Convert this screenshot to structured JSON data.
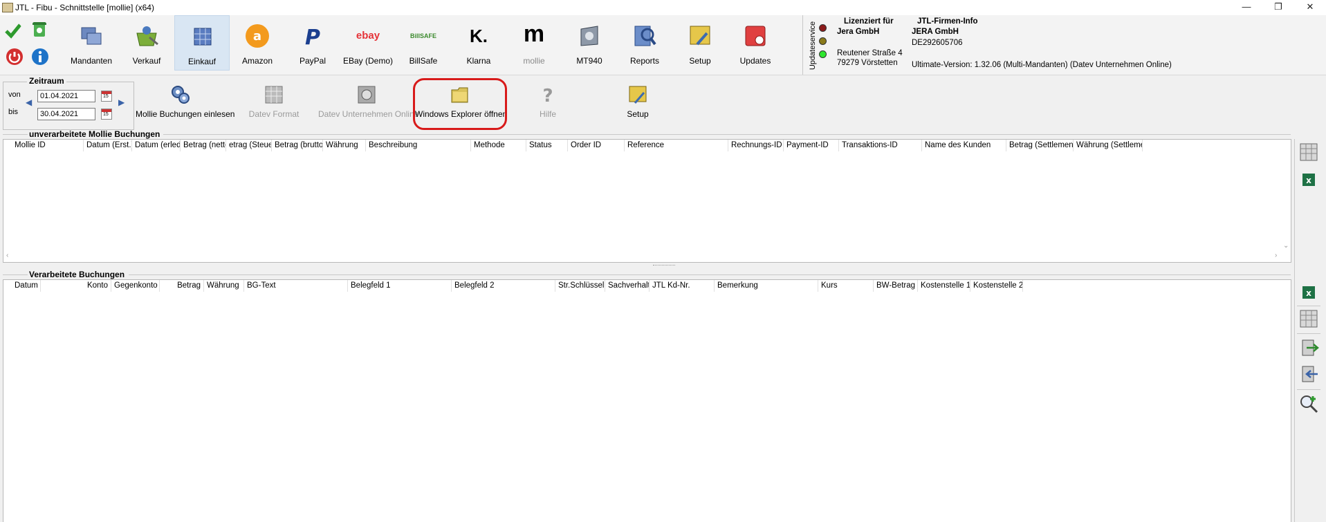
{
  "window": {
    "title": "JTL - Fibu - Schnittstelle [mollie] (x64)",
    "min": "—",
    "max": "❐",
    "close": "✕"
  },
  "modules": [
    {
      "label": "Mandanten",
      "icon": "mandanten-icon"
    },
    {
      "label": "Verkauf",
      "icon": "verkauf-basket-icon"
    },
    {
      "label": "Einkauf",
      "icon": "einkauf-icon"
    },
    {
      "label": "Amazon",
      "icon": "amazon-icon"
    },
    {
      "label": "PayPal",
      "icon": "paypal-icon"
    },
    {
      "label": "EBay (Demo)",
      "icon": "ebay-icon"
    },
    {
      "label": "BillSafe",
      "icon": "billsafe-icon"
    },
    {
      "label": "Klarna",
      "icon": "klarna-icon"
    },
    {
      "label": "mollie",
      "icon": "mollie-icon"
    },
    {
      "label": "MT940",
      "icon": "mt940-icon"
    },
    {
      "label": "Reports",
      "icon": "reports-icon"
    },
    {
      "label": "Setup",
      "icon": "setup-icon"
    },
    {
      "label": "Updates",
      "icon": "updates-icon"
    }
  ],
  "logos": {
    "ebay": "ebay",
    "billsafe": "BillSAFE",
    "klarna": "K.",
    "mollie": "m"
  },
  "updateservice": {
    "label": "Updateservice"
  },
  "license": {
    "header": "Lizenziert für",
    "company": "Jera GmbH",
    "street": "Reutener Straße 4",
    "city": "79279 Vörstetten"
  },
  "firm": {
    "header": "JTL-Firmen-Info",
    "company": "JERA GmbH",
    "vat": "DE292605706",
    "version": "Ultimate-Version: 1.32.06 (Multi-Mandanten) (Datev Unternehmen Online)"
  },
  "zeitraum": {
    "title": "Zeitraum",
    "von_label": "von",
    "bis_label": "bis",
    "von": "01.04.2021",
    "bis": "30.04.2021",
    "cal": "15"
  },
  "actions": [
    {
      "label": "Mollie Buchungen einlesen",
      "enabled": true
    },
    {
      "label": "Datev Format",
      "enabled": false
    },
    {
      "label": "Datev Unternehmen Online",
      "enabled": false
    },
    {
      "label": "Windows Explorer öffnen",
      "enabled": true
    },
    {
      "label": "Hilfe",
      "enabled": false
    },
    {
      "label": "Setup",
      "enabled": true
    }
  ],
  "unprocessed": {
    "title": "unverarbeitete Mollie Buchungen",
    "columns": [
      "Mollie ID",
      "Datum (Erst.)",
      "Datum (erledi",
      "Betrag (netto)",
      "etrag (Steuer)",
      "Betrag (brutto)",
      "Währung",
      "Beschreibung",
      "Methode",
      "Status",
      "Order ID",
      "Reference",
      "Rechnungs-ID",
      "Payment-ID",
      "Transaktions-ID",
      "Name des Kunden",
      "Betrag (Settlement)",
      "Währung (Settlemer"
    ]
  },
  "processed": {
    "title": "Verarbeitete Buchungen",
    "columns": [
      "Datum",
      "Konto",
      "Gegenkonto",
      "Betrag",
      "Währung",
      "BG-Text",
      "Belegfeld 1",
      "Belegfeld 2",
      "Str.Schlüssel",
      "Sachverhalt",
      "JTL Kd-Nr.",
      "Bemerkung",
      "Kurs",
      "BW-Betrag",
      "Kostenstelle 1",
      "Kostenstelle 2"
    ]
  },
  "colors": {
    "highlight": "#d81a1a",
    "accent": "#3a63a8",
    "active": "#d9e6f3"
  }
}
